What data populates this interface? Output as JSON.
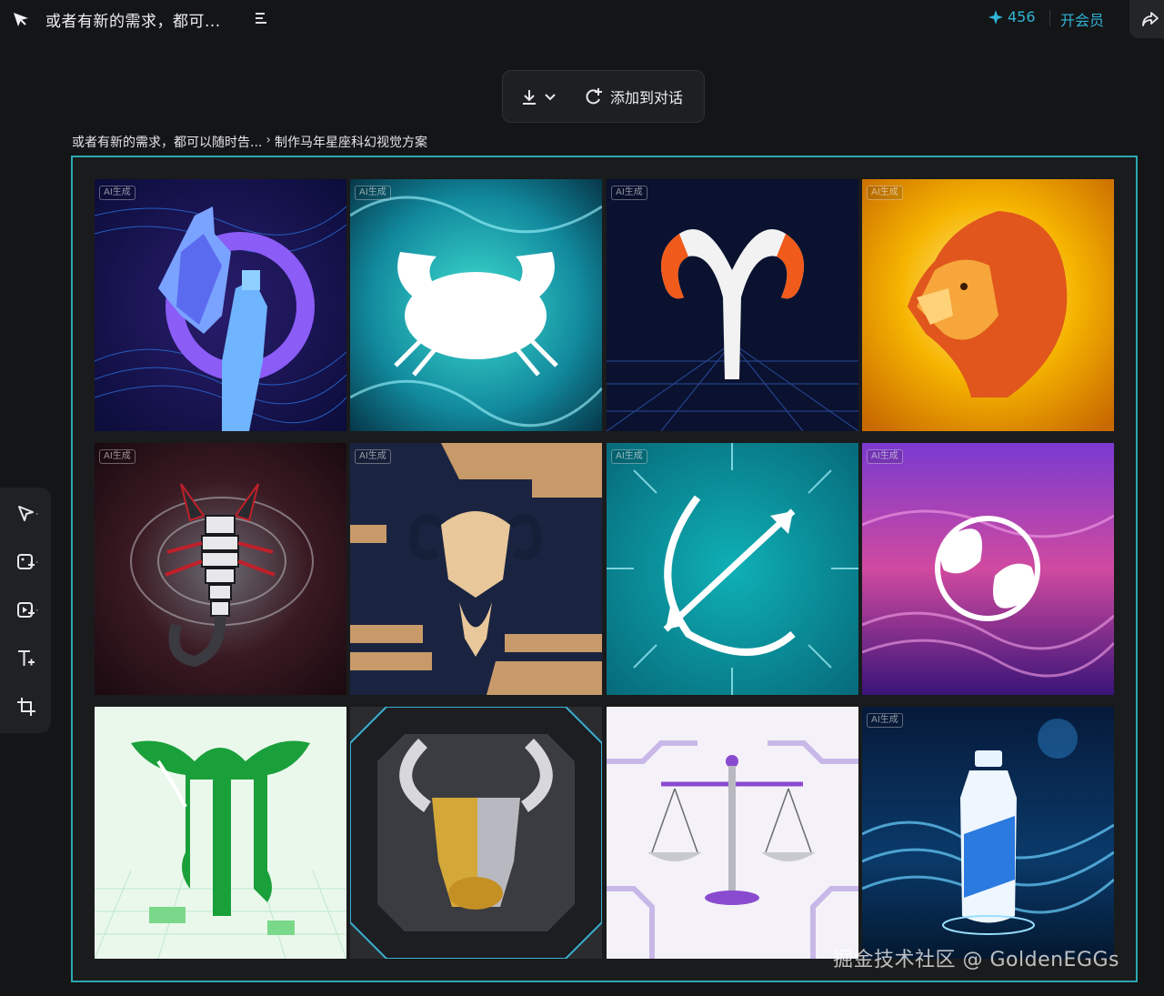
{
  "header": {
    "title": "或者有新的需求，都可...",
    "credits": "456",
    "member_label": "开会员",
    "accent_color": "#2fb4d6"
  },
  "toolbar": {
    "add_label": "添加到对话"
  },
  "breadcrumb": {
    "parent": "或者有新的需求，都可以随时告...",
    "separator": "›",
    "current": "制作马年星座科幻视觉方案"
  },
  "frame_color": "#2aa7b2",
  "images": [
    {
      "subject": "aquarius-figure",
      "badge": "AI生成"
    },
    {
      "subject": "cancer-crab",
      "badge": "AI生成"
    },
    {
      "subject": "aries-ram-symbol",
      "badge": "AI生成"
    },
    {
      "subject": "leo-lion",
      "badge": "AI生成"
    },
    {
      "subject": "scorpio-scorpion",
      "badge": "AI生成"
    },
    {
      "subject": "capricorn-goat",
      "badge": "AI生成"
    },
    {
      "subject": "sagittarius-bow",
      "badge": "AI生成"
    },
    {
      "subject": "pisces-fish",
      "badge": "AI生成"
    },
    {
      "subject": "virgo-symbol",
      "badge": ""
    },
    {
      "subject": "taurus-bull",
      "badge": ""
    },
    {
      "subject": "libra-scales",
      "badge": ""
    },
    {
      "subject": "water-bottle",
      "badge": "AI生成"
    }
  ],
  "tools": [
    "select-tool-icon",
    "image-edit-tool-icon",
    "video-add-tool-icon",
    "text-tool-icon",
    "crop-tool-icon"
  ],
  "watermark": "掘金技术社区 @ GoldenEGGs"
}
